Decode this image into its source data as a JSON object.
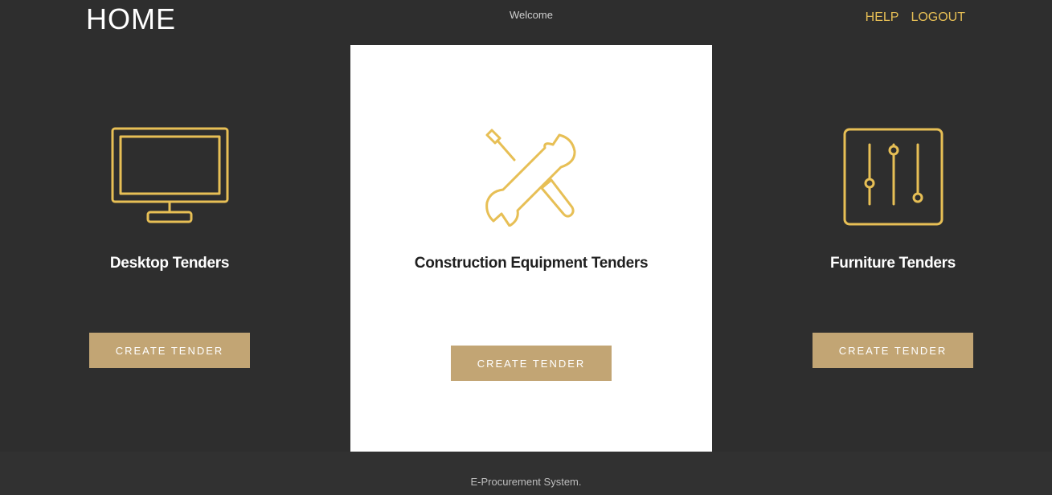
{
  "header": {
    "title": "HOME",
    "welcome": "Welcome",
    "nav": {
      "help": "HELP",
      "logout": "LOGOUT"
    }
  },
  "cards": [
    {
      "title": "Desktop Tenders",
      "button": "CREATE TENDER",
      "icon": "monitor-icon"
    },
    {
      "title": "Construction Equipment Tenders",
      "button": "CREATE TENDER",
      "icon": "tools-icon"
    },
    {
      "title": "Furniture Tenders",
      "button": "CREATE TENDER",
      "icon": "sliders-icon"
    }
  ],
  "footer": {
    "text": "E-Procurement System."
  },
  "colors": {
    "background": "#2e2e2e",
    "accent": "#e7bf55",
    "button": "#c2a574",
    "highlight_card": "#ffffff"
  }
}
